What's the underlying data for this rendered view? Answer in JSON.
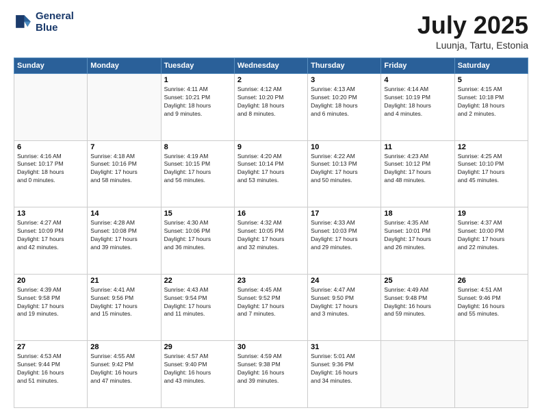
{
  "logo": {
    "line1": "General",
    "line2": "Blue"
  },
  "title": {
    "month": "July 2025",
    "location": "Luunja, Tartu, Estonia"
  },
  "weekdays": [
    "Sunday",
    "Monday",
    "Tuesday",
    "Wednesday",
    "Thursday",
    "Friday",
    "Saturday"
  ],
  "weeks": [
    [
      {
        "day": "",
        "info": ""
      },
      {
        "day": "",
        "info": ""
      },
      {
        "day": "1",
        "info": "Sunrise: 4:11 AM\nSunset: 10:21 PM\nDaylight: 18 hours\nand 9 minutes."
      },
      {
        "day": "2",
        "info": "Sunrise: 4:12 AM\nSunset: 10:20 PM\nDaylight: 18 hours\nand 8 minutes."
      },
      {
        "day": "3",
        "info": "Sunrise: 4:13 AM\nSunset: 10:20 PM\nDaylight: 18 hours\nand 6 minutes."
      },
      {
        "day": "4",
        "info": "Sunrise: 4:14 AM\nSunset: 10:19 PM\nDaylight: 18 hours\nand 4 minutes."
      },
      {
        "day": "5",
        "info": "Sunrise: 4:15 AM\nSunset: 10:18 PM\nDaylight: 18 hours\nand 2 minutes."
      }
    ],
    [
      {
        "day": "6",
        "info": "Sunrise: 4:16 AM\nSunset: 10:17 PM\nDaylight: 18 hours\nand 0 minutes."
      },
      {
        "day": "7",
        "info": "Sunrise: 4:18 AM\nSunset: 10:16 PM\nDaylight: 17 hours\nand 58 minutes."
      },
      {
        "day": "8",
        "info": "Sunrise: 4:19 AM\nSunset: 10:15 PM\nDaylight: 17 hours\nand 56 minutes."
      },
      {
        "day": "9",
        "info": "Sunrise: 4:20 AM\nSunset: 10:14 PM\nDaylight: 17 hours\nand 53 minutes."
      },
      {
        "day": "10",
        "info": "Sunrise: 4:22 AM\nSunset: 10:13 PM\nDaylight: 17 hours\nand 50 minutes."
      },
      {
        "day": "11",
        "info": "Sunrise: 4:23 AM\nSunset: 10:12 PM\nDaylight: 17 hours\nand 48 minutes."
      },
      {
        "day": "12",
        "info": "Sunrise: 4:25 AM\nSunset: 10:10 PM\nDaylight: 17 hours\nand 45 minutes."
      }
    ],
    [
      {
        "day": "13",
        "info": "Sunrise: 4:27 AM\nSunset: 10:09 PM\nDaylight: 17 hours\nand 42 minutes."
      },
      {
        "day": "14",
        "info": "Sunrise: 4:28 AM\nSunset: 10:08 PM\nDaylight: 17 hours\nand 39 minutes."
      },
      {
        "day": "15",
        "info": "Sunrise: 4:30 AM\nSunset: 10:06 PM\nDaylight: 17 hours\nand 36 minutes."
      },
      {
        "day": "16",
        "info": "Sunrise: 4:32 AM\nSunset: 10:05 PM\nDaylight: 17 hours\nand 32 minutes."
      },
      {
        "day": "17",
        "info": "Sunrise: 4:33 AM\nSunset: 10:03 PM\nDaylight: 17 hours\nand 29 minutes."
      },
      {
        "day": "18",
        "info": "Sunrise: 4:35 AM\nSunset: 10:01 PM\nDaylight: 17 hours\nand 26 minutes."
      },
      {
        "day": "19",
        "info": "Sunrise: 4:37 AM\nSunset: 10:00 PM\nDaylight: 17 hours\nand 22 minutes."
      }
    ],
    [
      {
        "day": "20",
        "info": "Sunrise: 4:39 AM\nSunset: 9:58 PM\nDaylight: 17 hours\nand 19 minutes."
      },
      {
        "day": "21",
        "info": "Sunrise: 4:41 AM\nSunset: 9:56 PM\nDaylight: 17 hours\nand 15 minutes."
      },
      {
        "day": "22",
        "info": "Sunrise: 4:43 AM\nSunset: 9:54 PM\nDaylight: 17 hours\nand 11 minutes."
      },
      {
        "day": "23",
        "info": "Sunrise: 4:45 AM\nSunset: 9:52 PM\nDaylight: 17 hours\nand 7 minutes."
      },
      {
        "day": "24",
        "info": "Sunrise: 4:47 AM\nSunset: 9:50 PM\nDaylight: 17 hours\nand 3 minutes."
      },
      {
        "day": "25",
        "info": "Sunrise: 4:49 AM\nSunset: 9:48 PM\nDaylight: 16 hours\nand 59 minutes."
      },
      {
        "day": "26",
        "info": "Sunrise: 4:51 AM\nSunset: 9:46 PM\nDaylight: 16 hours\nand 55 minutes."
      }
    ],
    [
      {
        "day": "27",
        "info": "Sunrise: 4:53 AM\nSunset: 9:44 PM\nDaylight: 16 hours\nand 51 minutes."
      },
      {
        "day": "28",
        "info": "Sunrise: 4:55 AM\nSunset: 9:42 PM\nDaylight: 16 hours\nand 47 minutes."
      },
      {
        "day": "29",
        "info": "Sunrise: 4:57 AM\nSunset: 9:40 PM\nDaylight: 16 hours\nand 43 minutes."
      },
      {
        "day": "30",
        "info": "Sunrise: 4:59 AM\nSunset: 9:38 PM\nDaylight: 16 hours\nand 39 minutes."
      },
      {
        "day": "31",
        "info": "Sunrise: 5:01 AM\nSunset: 9:36 PM\nDaylight: 16 hours\nand 34 minutes."
      },
      {
        "day": "",
        "info": ""
      },
      {
        "day": "",
        "info": ""
      }
    ]
  ]
}
